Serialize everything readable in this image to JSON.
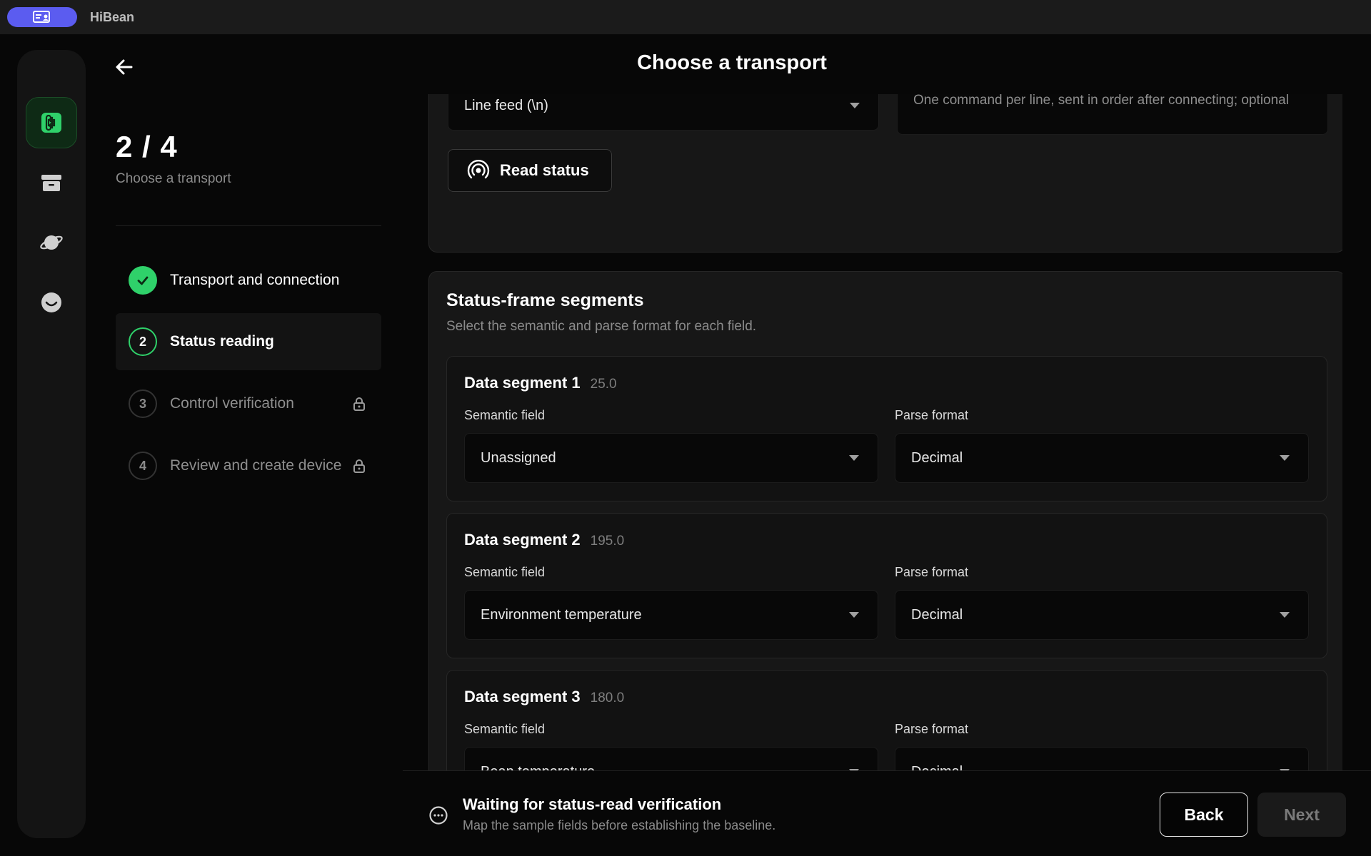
{
  "app": {
    "name": "HiBean"
  },
  "header": {
    "title": "Choose a transport"
  },
  "progress": {
    "step_count": "2 / 4",
    "subtitle": "Choose a transport"
  },
  "steps": [
    {
      "number": "",
      "label": "Transport and connection",
      "state": "done"
    },
    {
      "number": "2",
      "label": "Status reading",
      "state": "current"
    },
    {
      "number": "3",
      "label": "Control verification",
      "state": "locked"
    },
    {
      "number": "4",
      "label": "Review and create device",
      "state": "locked"
    }
  ],
  "transport_card": {
    "line_ending_value": "Line feed (\\n)",
    "init_commands_placeholder": "One command per line, sent in order after connecting; optional",
    "read_status_label": "Read status"
  },
  "segments_card": {
    "title": "Status-frame segments",
    "subtitle": "Select the semantic and parse format for each field.",
    "semantic_label": "Semantic field",
    "parse_label": "Parse format",
    "segments": [
      {
        "title": "Data segment 1",
        "sample": "25.0",
        "semantic": "Unassigned",
        "format": "Decimal"
      },
      {
        "title": "Data segment 2",
        "sample": "195.0",
        "semantic": "Environment temperature",
        "format": "Decimal"
      },
      {
        "title": "Data segment 3",
        "sample": "180.0",
        "semantic": "Bean temperature",
        "format": "Decimal"
      }
    ]
  },
  "footer": {
    "status_title": "Waiting for status-read verification",
    "status_sub": "Map the sample fields before establishing the baseline.",
    "back_label": "Back",
    "next_label": "Next"
  },
  "colors": {
    "accent": "#2fd16a",
    "title_pill": "#5b5cf0",
    "background": "#070707"
  },
  "icons": [
    "app-window-icon",
    "command-icon",
    "archive-icon",
    "planet-icon",
    "smile-icon",
    "back-arrow-icon",
    "check-icon",
    "lock-icon",
    "broadcast-icon",
    "more-circle-icon"
  ]
}
